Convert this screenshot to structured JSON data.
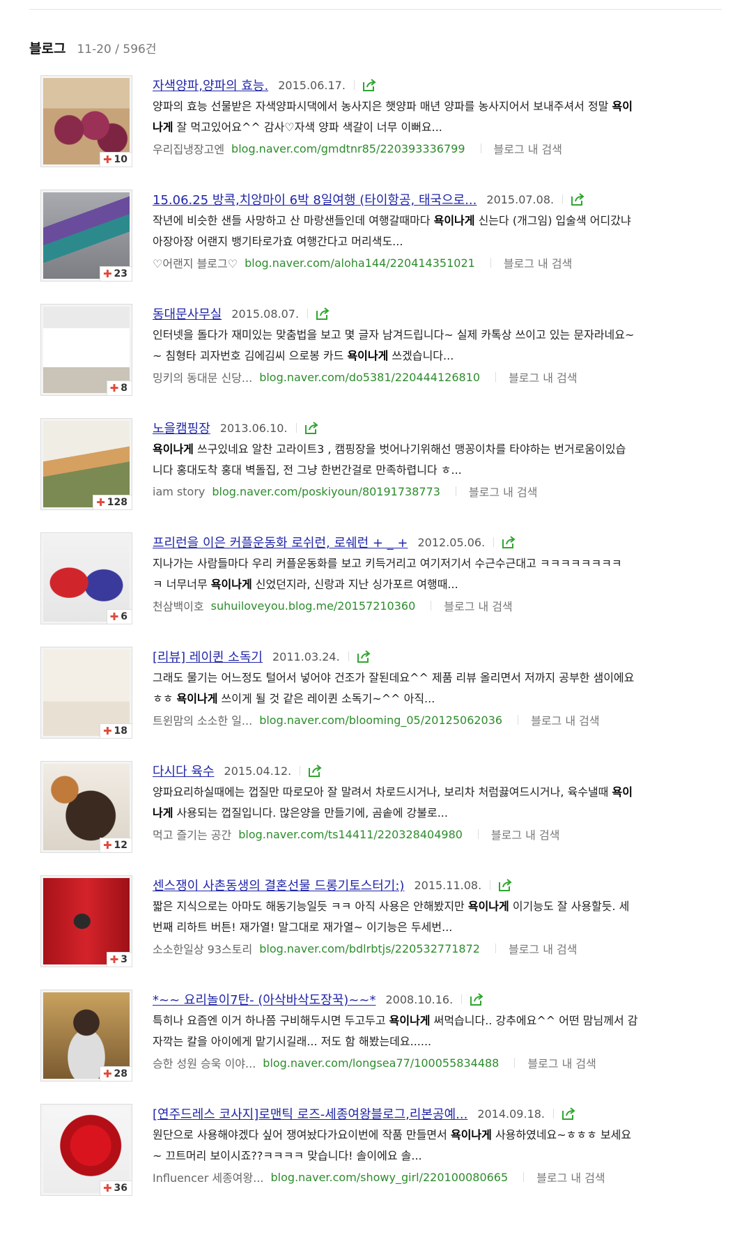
{
  "section": {
    "title": "블로그",
    "count": "11-20 / 596건"
  },
  "in_blog_label": "블로그 내 검색",
  "colors": {
    "title": "#2026a8",
    "url": "#2c8c2c",
    "plus": "#e0493c",
    "share": "#2fa52f"
  },
  "results": [
    {
      "title": "자색양파,양파의 효능.",
      "date": "2015.06.17.",
      "desc1_pre": "양파의 효능 선물받은 자색양파시댁에서 농사지은 햇양파 매년 양파를 농사지어서 보내주셔서 정말 ",
      "desc1_bold": "욕이",
      "desc1_post": "",
      "desc2_pre": "",
      "desc2_bold": "나게",
      "desc2_post": " 잘 먹고있어요^^ 감사♡자색 양파 색갈이 너무 이뻐요...",
      "author": "우리집냉장고엔",
      "url": "blog.naver.com/gmdtnr85/220393336799",
      "count": "10",
      "thumb": "onion"
    },
    {
      "title": "15.06.25 방콕,치앙마이 6박 8일여행 (타이항공, 태국으로...",
      "date": "2015.07.08.",
      "desc1_pre": "작년에 비슷한 샌들 사망하고 산 마랑샌들인데 여행갈때마다 ",
      "desc1_bold": "욕이나게",
      "desc1_post": " 신는다 (개그임) 입술색 어디갔냐",
      "desc2_pre": "아장아장 어랜지 뱅기타로가효 여행간다고 머리색도...",
      "desc2_bold": "",
      "desc2_post": "",
      "author": "♡어랜지 블로그♡",
      "url": "blog.naver.com/aloha144/220414351021",
      "count": "23",
      "thumb": "travel"
    },
    {
      "title": "동대문사무실",
      "date": "2015.08.07.",
      "desc1_pre": "인터넷을 돌다가 재미있는 맞춤법을 보고 몇 글자 남겨드립니다~ 실제 카톡상 쓰이고 있는 문자라네요~",
      "desc1_bold": "",
      "desc1_post": "",
      "desc2_pre": "~ 침형타 괴자번호 김에김씨 으로봉 카드 ",
      "desc2_bold": "욕이나게",
      "desc2_post": " 쓰겠습니다...",
      "author": "밍키의 동대문 신당...",
      "url": "blog.naver.com/do5381/220444126810",
      "count": "8",
      "thumb": "office"
    },
    {
      "title": "노을캠핑장",
      "date": "2013.06.10.",
      "desc1_pre": "",
      "desc1_bold": "욕이나게",
      "desc1_post": " 쓰구있네요 알찬 고라이트3 , 캠핑장을 벗어나기위해선 맹꽁이차를 타야하는 번거로움이있습",
      "desc2_pre": "니다 홍대도착 홍대 벽돌집, 전 그냥 한번간걸로 만족하렵니다 ㅎ...",
      "desc2_bold": "",
      "desc2_post": "",
      "author": "iam story",
      "url": "blog.naver.com/poskiyoun/80191738773",
      "count": "128",
      "thumb": "camp"
    },
    {
      "title": "프리런을 이은 커플운동화 로쉬런, 로쉐런 + _ +",
      "date": "2012.05.06.",
      "desc1_pre": "지나가는 사람들마다 우리 커플운동화를 보고 키득거리고 여기저기서 수근수근대고 ㅋㅋㅋㅋㅋㅋㅋㅋ",
      "desc1_bold": "",
      "desc1_post": "",
      "desc2_pre": "ㅋ 너무너무 ",
      "desc2_bold": "욕이나게",
      "desc2_post": " 신었던지라, 신랑과 지난 싱가포르 여행때...",
      "author": "천삼백이호",
      "url": "suhuiloveyou.blog.me/20157210360",
      "count": "6",
      "thumb": "shoes"
    },
    {
      "title": "[리뷰] 레이퀸 소독기",
      "date": "2011.03.24.",
      "desc1_pre": "그래도 물기는 어느정도 털어서 넣어야 건조가 잘된데요^^ 제품 리뷰 올리면서 저까지 공부한 샘이에요",
      "desc1_bold": "",
      "desc1_post": "",
      "desc2_pre": "ㅎㅎ ",
      "desc2_bold": "욕이나게",
      "desc2_post": " 쓰이게 될 것 같은 레이퀸 소독기~^^ 아직...",
      "author": "트윈맘의 소소한 일...",
      "url": "blog.naver.com/blooming_05/20125062036",
      "count": "18",
      "thumb": "box"
    },
    {
      "title": "다시다 육수",
      "date": "2015.04.12.",
      "desc1_pre": "양파요리하실때에는 껍질만 따로모아 잘 말려서 차로드시거나, 보리차 처럼끓여드시거나, 육수낼때 ",
      "desc1_bold": "욕이",
      "desc1_post": "",
      "desc2_pre": "",
      "desc2_bold": "나게",
      "desc2_post": " 사용되는 껍질입니다. 많은양을 만들기에, 곰솥에 강불로...",
      "author": "먹고 즐기는 공간",
      "url": "blog.naver.com/ts14411/220328404980",
      "count": "12",
      "thumb": "food"
    },
    {
      "title": "센스쟁이 사촌동생의 결혼선물 드롱기토스터기:)",
      "date": "2015.11.08.",
      "desc1_pre": "짧은 지식으로는 아마도 해동기능일듯 ㅋㅋ 아직 사용은 안해봤지만 ",
      "desc1_bold": "욕이나게",
      "desc1_post": " 이기능도 잘 사용할듯. 세",
      "desc2_pre": "번째 리하트 버튼! 재가열! 말그대로 재가열~ 이기능은 두세번...",
      "desc2_bold": "",
      "desc2_post": "",
      "author": "소소한일상 93스토리",
      "url": "blog.naver.com/bdlrbtjs/220532771872",
      "count": "3",
      "thumb": "toaster"
    },
    {
      "title": "*~~ 요리놀이7탄- (아삭바삭도장꾹)~~*",
      "date": "2008.10.16.",
      "desc1_pre": "특히나 요즘엔 이거 하나쯤 구비해두시면 두고두고 ",
      "desc1_bold": "욕이나게",
      "desc1_post": " 써먹습니다.. 강추에요^^ 어떤 맘님께서 감",
      "desc2_pre": "자깍는 칼을 아이에게 맡기시길래... 저도 함 해봤는데요......",
      "desc2_bold": "",
      "desc2_post": "",
      "author": "승한 성원 승욱 이야...",
      "url": "blog.naver.com/longsea77/100055834488",
      "count": "28",
      "thumb": "kid"
    },
    {
      "title": "[연주드레스 코사지]로맨틱 로즈-세종여왕블로그,리본공예...",
      "date": "2014.09.18.",
      "desc1_pre": "원단으로 사용해야겠다 싶어 쟁여놨다가요이번에 작품 만들면서 ",
      "desc1_bold": "욕이나게",
      "desc1_post": " 사용하였네요~ㅎㅎㅎ 보세요",
      "desc2_pre": "~ 끄트머리 보이시죠??ㅋㅋㅋㅋ 맞습니다! 솔이에요 솔...",
      "desc2_bold": "",
      "desc2_post": "",
      "author": "Influencer 세종여왕...",
      "url": "blog.naver.com/showy_girl/220100080665",
      "count": "36",
      "thumb": "rose"
    }
  ]
}
